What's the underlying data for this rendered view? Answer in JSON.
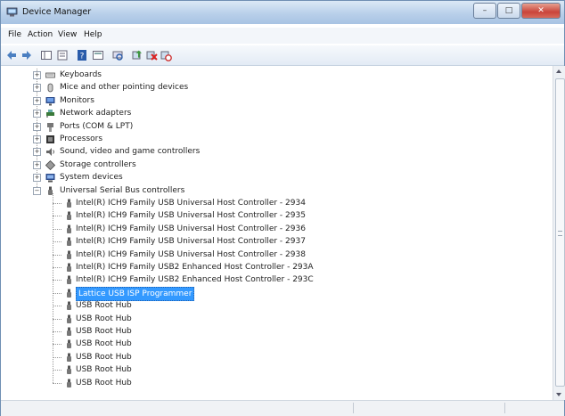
{
  "window": {
    "title": "Device Manager",
    "caption_buttons": {
      "minimize": "–",
      "maximize": "□",
      "close": "✕"
    }
  },
  "menu": {
    "items": [
      "File",
      "Action",
      "View",
      "Help"
    ]
  },
  "tree": {
    "categories": [
      {
        "label": "Keyboards",
        "icon": "keyboard-icon"
      },
      {
        "label": "Mice and other pointing devices",
        "icon": "mouse-icon"
      },
      {
        "label": "Monitors",
        "icon": "monitor-icon"
      },
      {
        "label": "Network adapters",
        "icon": "network-adapter-icon"
      },
      {
        "label": "Ports (COM & LPT)",
        "icon": "port-icon"
      },
      {
        "label": "Processors",
        "icon": "processor-icon"
      },
      {
        "label": "Sound, video and game controllers",
        "icon": "sound-icon"
      },
      {
        "label": "Storage controllers",
        "icon": "storage-icon"
      },
      {
        "label": "System devices",
        "icon": "system-devices-icon"
      },
      {
        "label": "Universal Serial Bus controllers",
        "icon": "usb-icon"
      }
    ],
    "usb_children": [
      "Intel(R) ICH9 Family USB Universal Host Controller - 2934",
      "Intel(R) ICH9 Family USB Universal Host Controller - 2935",
      "Intel(R) ICH9 Family USB Universal Host Controller - 2936",
      "Intel(R) ICH9 Family USB Universal Host Controller - 2937",
      "Intel(R) ICH9 Family USB Universal Host Controller - 2938",
      "Intel(R) ICH9 Family USB2 Enhanced Host Controller - 293A",
      "Intel(R) ICH9 Family USB2 Enhanced Host Controller - 293C",
      "Lattice USB ISP Programmer",
      "USB Root Hub",
      "USB Root Hub",
      "USB Root Hub",
      "USB Root Hub",
      "USB Root Hub",
      "USB Root Hub",
      "USB Root Hub"
    ],
    "selected_label": "Lattice USB ISP Programmer"
  },
  "expander_symbols": {
    "collapsed": "+",
    "expanded": "−"
  },
  "colors": {
    "selection": "#3399ff",
    "titlebar": "#b9d0ea"
  }
}
